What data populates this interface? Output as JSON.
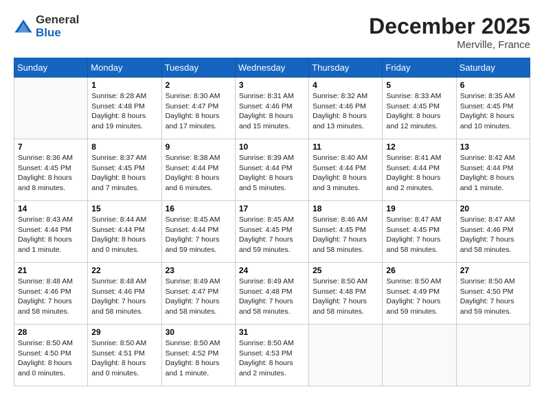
{
  "header": {
    "logo_general": "General",
    "logo_blue": "Blue",
    "month_title": "December 2025",
    "location": "Merville, France"
  },
  "days_of_week": [
    "Sunday",
    "Monday",
    "Tuesday",
    "Wednesday",
    "Thursday",
    "Friday",
    "Saturday"
  ],
  "weeks": [
    [
      {
        "day": "",
        "info": ""
      },
      {
        "day": "1",
        "info": "Sunrise: 8:28 AM\nSunset: 4:48 PM\nDaylight: 8 hours\nand 19 minutes."
      },
      {
        "day": "2",
        "info": "Sunrise: 8:30 AM\nSunset: 4:47 PM\nDaylight: 8 hours\nand 17 minutes."
      },
      {
        "day": "3",
        "info": "Sunrise: 8:31 AM\nSunset: 4:46 PM\nDaylight: 8 hours\nand 15 minutes."
      },
      {
        "day": "4",
        "info": "Sunrise: 8:32 AM\nSunset: 4:46 PM\nDaylight: 8 hours\nand 13 minutes."
      },
      {
        "day": "5",
        "info": "Sunrise: 8:33 AM\nSunset: 4:45 PM\nDaylight: 8 hours\nand 12 minutes."
      },
      {
        "day": "6",
        "info": "Sunrise: 8:35 AM\nSunset: 4:45 PM\nDaylight: 8 hours\nand 10 minutes."
      }
    ],
    [
      {
        "day": "7",
        "info": "Sunrise: 8:36 AM\nSunset: 4:45 PM\nDaylight: 8 hours\nand 8 minutes."
      },
      {
        "day": "8",
        "info": "Sunrise: 8:37 AM\nSunset: 4:45 PM\nDaylight: 8 hours\nand 7 minutes."
      },
      {
        "day": "9",
        "info": "Sunrise: 8:38 AM\nSunset: 4:44 PM\nDaylight: 8 hours\nand 6 minutes."
      },
      {
        "day": "10",
        "info": "Sunrise: 8:39 AM\nSunset: 4:44 PM\nDaylight: 8 hours\nand 5 minutes."
      },
      {
        "day": "11",
        "info": "Sunrise: 8:40 AM\nSunset: 4:44 PM\nDaylight: 8 hours\nand 3 minutes."
      },
      {
        "day": "12",
        "info": "Sunrise: 8:41 AM\nSunset: 4:44 PM\nDaylight: 8 hours\nand 2 minutes."
      },
      {
        "day": "13",
        "info": "Sunrise: 8:42 AM\nSunset: 4:44 PM\nDaylight: 8 hours\nand 1 minute."
      }
    ],
    [
      {
        "day": "14",
        "info": "Sunrise: 8:43 AM\nSunset: 4:44 PM\nDaylight: 8 hours\nand 1 minute."
      },
      {
        "day": "15",
        "info": "Sunrise: 8:44 AM\nSunset: 4:44 PM\nDaylight: 8 hours\nand 0 minutes."
      },
      {
        "day": "16",
        "info": "Sunrise: 8:45 AM\nSunset: 4:44 PM\nDaylight: 7 hours\nand 59 minutes."
      },
      {
        "day": "17",
        "info": "Sunrise: 8:45 AM\nSunset: 4:45 PM\nDaylight: 7 hours\nand 59 minutes."
      },
      {
        "day": "18",
        "info": "Sunrise: 8:46 AM\nSunset: 4:45 PM\nDaylight: 7 hours\nand 58 minutes."
      },
      {
        "day": "19",
        "info": "Sunrise: 8:47 AM\nSunset: 4:45 PM\nDaylight: 7 hours\nand 58 minutes."
      },
      {
        "day": "20",
        "info": "Sunrise: 8:47 AM\nSunset: 4:46 PM\nDaylight: 7 hours\nand 58 minutes."
      }
    ],
    [
      {
        "day": "21",
        "info": "Sunrise: 8:48 AM\nSunset: 4:46 PM\nDaylight: 7 hours\nand 58 minutes."
      },
      {
        "day": "22",
        "info": "Sunrise: 8:48 AM\nSunset: 4:46 PM\nDaylight: 7 hours\nand 58 minutes."
      },
      {
        "day": "23",
        "info": "Sunrise: 8:49 AM\nSunset: 4:47 PM\nDaylight: 7 hours\nand 58 minutes."
      },
      {
        "day": "24",
        "info": "Sunrise: 8:49 AM\nSunset: 4:48 PM\nDaylight: 7 hours\nand 58 minutes."
      },
      {
        "day": "25",
        "info": "Sunrise: 8:50 AM\nSunset: 4:48 PM\nDaylight: 7 hours\nand 58 minutes."
      },
      {
        "day": "26",
        "info": "Sunrise: 8:50 AM\nSunset: 4:49 PM\nDaylight: 7 hours\nand 59 minutes."
      },
      {
        "day": "27",
        "info": "Sunrise: 8:50 AM\nSunset: 4:50 PM\nDaylight: 7 hours\nand 59 minutes."
      }
    ],
    [
      {
        "day": "28",
        "info": "Sunrise: 8:50 AM\nSunset: 4:50 PM\nDaylight: 8 hours\nand 0 minutes."
      },
      {
        "day": "29",
        "info": "Sunrise: 8:50 AM\nSunset: 4:51 PM\nDaylight: 8 hours\nand 0 minutes."
      },
      {
        "day": "30",
        "info": "Sunrise: 8:50 AM\nSunset: 4:52 PM\nDaylight: 8 hours\nand 1 minute."
      },
      {
        "day": "31",
        "info": "Sunrise: 8:50 AM\nSunset: 4:53 PM\nDaylight: 8 hours\nand 2 minutes."
      },
      {
        "day": "",
        "info": ""
      },
      {
        "day": "",
        "info": ""
      },
      {
        "day": "",
        "info": ""
      }
    ]
  ]
}
